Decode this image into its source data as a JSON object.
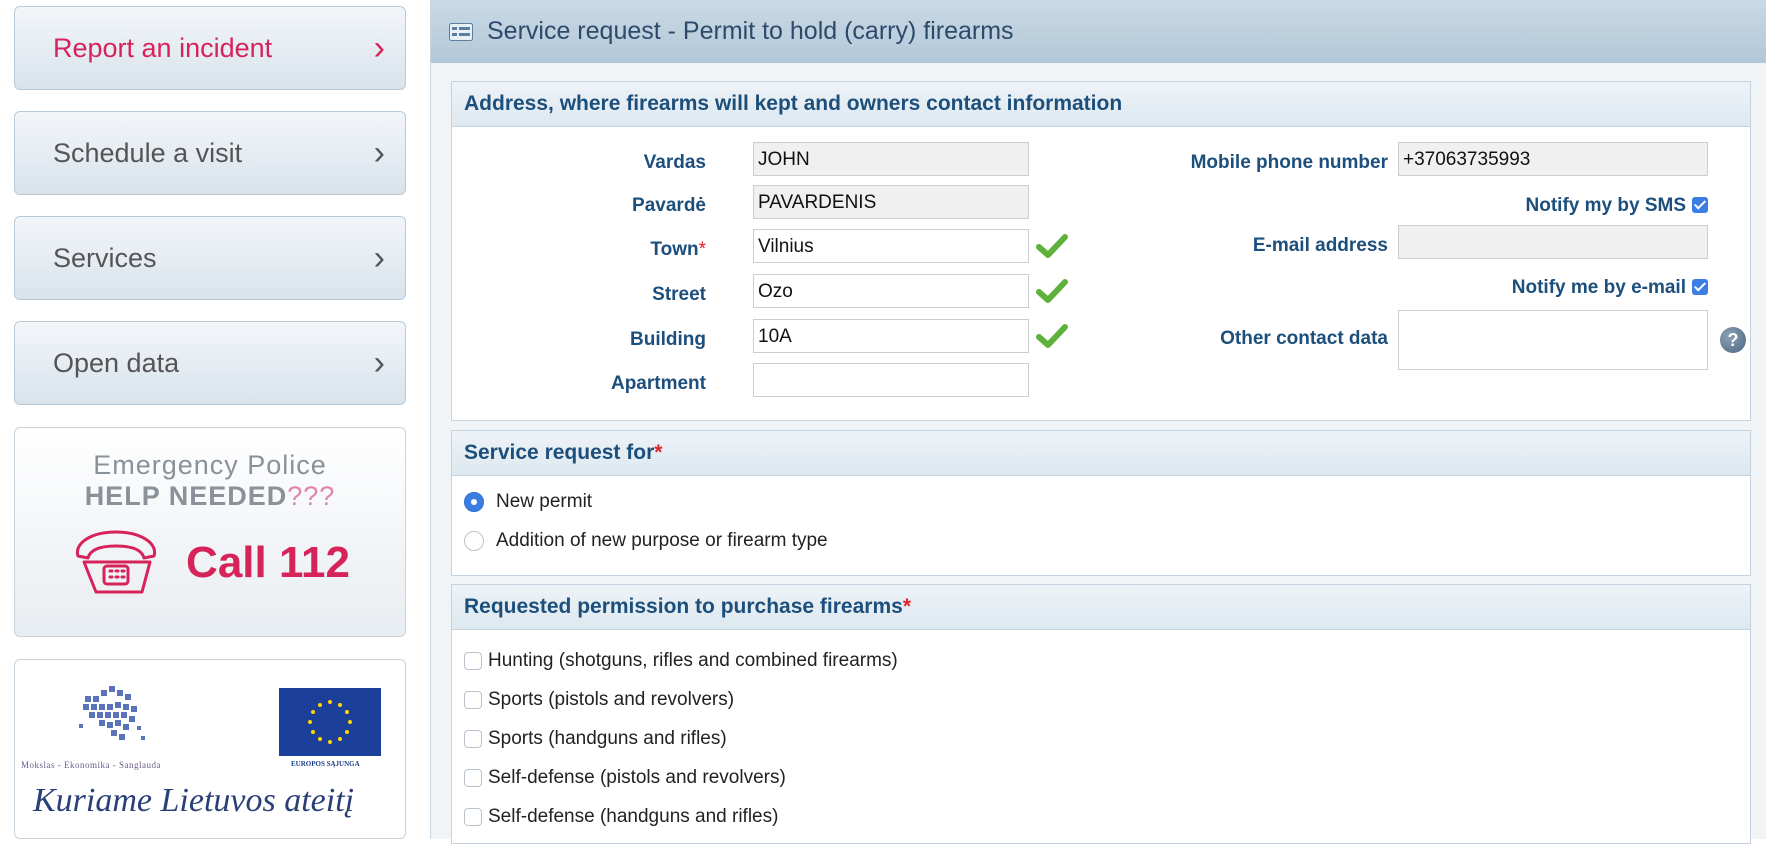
{
  "sidebar": {
    "items": [
      {
        "label": "Report an incident",
        "chevron": "›"
      },
      {
        "label": "Schedule a visit",
        "chevron": "›"
      },
      {
        "label": "Services",
        "chevron": "›"
      },
      {
        "label": "Open data",
        "chevron": "›"
      }
    ],
    "emergency": {
      "line1": "Emergency Police",
      "line2_bold": "HELP NEEDED",
      "line2_suffix": "???",
      "call": "Call 112"
    },
    "logos": {
      "caption_left": "Mokslas - Ekonomika - Sanglauda",
      "caption_right": "EUROPOS SĄJUNGA",
      "motto": "Kuriame Lietuvos ateitį"
    }
  },
  "main": {
    "title": "Service request - Permit to hold (carry) firearms",
    "address_section": {
      "header": "Address, where firearms will kept and owners contact information",
      "vardas_label": "Vardas",
      "vardas_value": "JOHN",
      "pavarde_label": "Pavardė",
      "pavarde_value": "PAVARDENIS",
      "town_label": "Town",
      "town_required": "*",
      "town_value": "Vilnius",
      "street_label": "Street",
      "street_value": "Ozo",
      "building_label": "Building",
      "building_value": "10A",
      "apartment_label": "Apartment",
      "apartment_value": "",
      "mobile_label": "Mobile phone number",
      "mobile_value": "+37063735993",
      "notify_sms_label": "Notify my by SMS",
      "notify_sms_checked": true,
      "email_label": "E-mail address",
      "email_value": "",
      "notify_email_label": "Notify me by e-mail",
      "notify_email_checked": true,
      "other_contact_label": "Other contact data",
      "other_contact_value": "",
      "help_icon": "?"
    },
    "request_for_section": {
      "header": "Service request for",
      "required": "*",
      "options": [
        {
          "label": "New permit",
          "selected": true
        },
        {
          "label": "Addition of new purpose or firearm type",
          "selected": false
        }
      ]
    },
    "purchase_section": {
      "header": "Requested permission to purchase firearms",
      "required": "*",
      "options": [
        {
          "label": "Hunting (shotguns, rifles and combined firearms)",
          "checked": false
        },
        {
          "label": "Sports (pistols and revolvers)",
          "checked": false
        },
        {
          "label": "Sports (handguns and rifles)",
          "checked": false
        },
        {
          "label": "Self-defense (pistols and revolvers)",
          "checked": false
        },
        {
          "label": "Self-defense (handguns and rifles)",
          "checked": false
        }
      ]
    }
  },
  "colors": {
    "accent": "#d6245a",
    "heading_blue": "#1d4f7c",
    "checkbox_blue": "#3b7de3",
    "valid_green": "#5fb13b"
  }
}
